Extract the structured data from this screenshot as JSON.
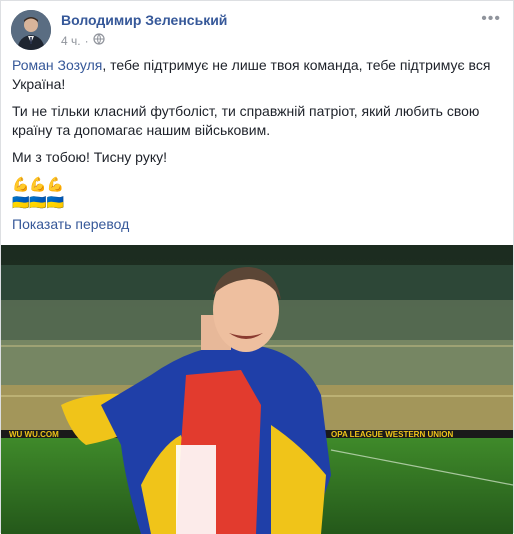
{
  "post": {
    "author": "Володимир Зеленський",
    "time": "4 ч.",
    "separator": "·",
    "more_label": "•••",
    "mention": "Роман Зозуля",
    "paragraph1_rest": ", тебе підтримує не лише твоя команда, тебе підтримує вся Україна!",
    "paragraph2": "Ти не тільки класний футболіст, ти справжній патріот, який любить свою країну та допомагає нашим військовим.",
    "paragraph3": "Ми з тобою! Тисну руку!",
    "emoji_line1": "💪💪💪",
    "emoji_line2": "🇺🇦🇺🇦🇺🇦",
    "translate_link": "Показать перевод"
  },
  "photo": {
    "board_left": "WU  WU.COM",
    "board_right": "OPA LEAGUE  WESTERN UNION"
  },
  "colors": {
    "link": "#365899",
    "text": "#1d2129",
    "meta": "#90949c",
    "pitch": "#2e6b1e",
    "flag_blue": "#1f3fa8",
    "flag_yellow": "#f0c419"
  }
}
